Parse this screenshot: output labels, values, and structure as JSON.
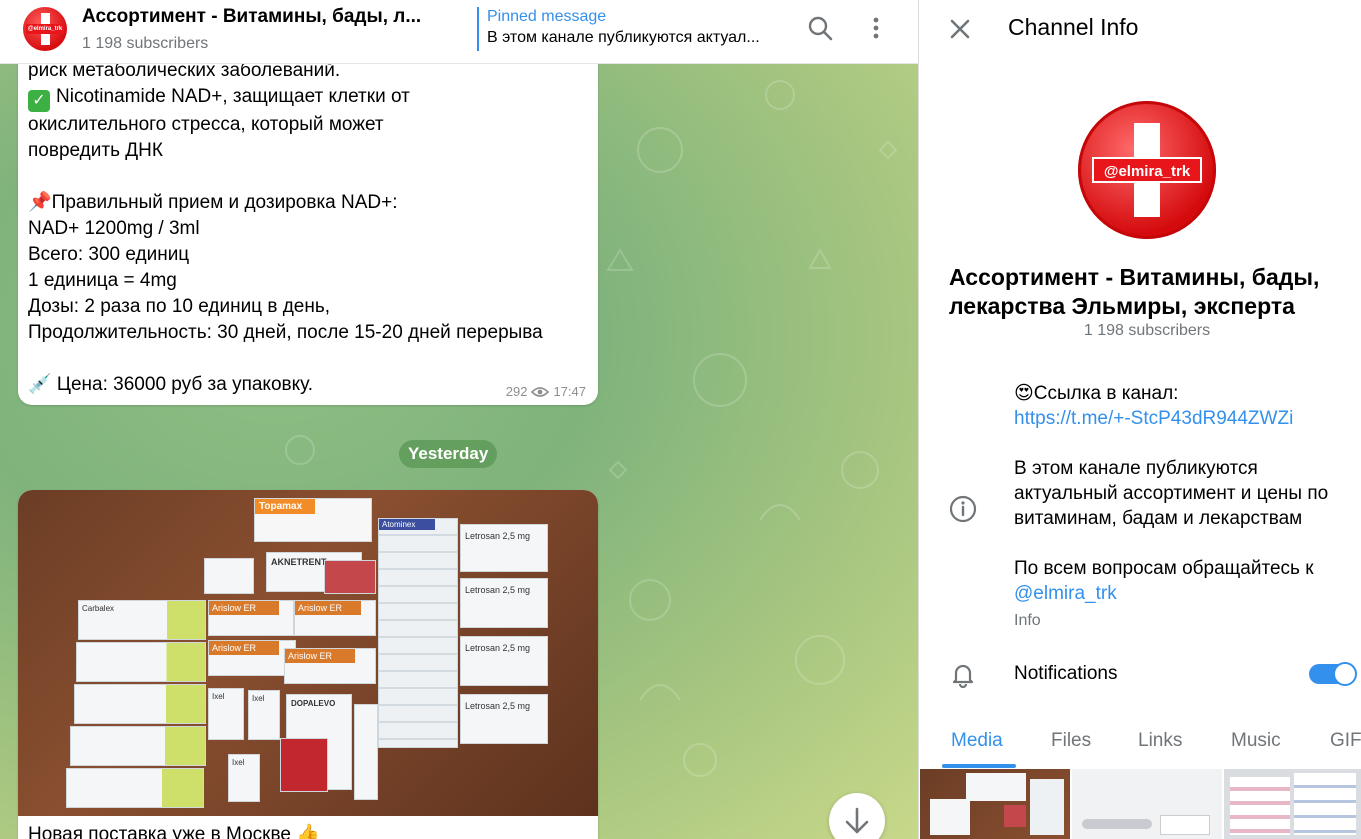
{
  "header": {
    "avatar_tag": "@elmira_trk",
    "title": "Ассортимент - Витамины, бады, л...",
    "subscribers": "1 198 subscribers",
    "pinned_label": "Pinned message",
    "pinned_text": "В этом канале публикуются актуал...",
    "search_icon": "search-icon",
    "more_icon": "more-vertical-icon"
  },
  "messages": [
    {
      "lines": [
        "риск метаболических заболеваний.",
        "Nicotinamide NAD+, защищает клетки от",
        "окислительного стресса, который может",
        "повредить ДНК",
        "",
        "📌Правильный прием и дозировка NAD+:",
        "NAD+ 1200mg / 3ml",
        "Всего: 300 единиц",
        "1 единица = 4mg",
        "Дозы: 2 раза по 10 единиц в день,",
        "Продолжительность: 30 дней, после 15-20 дней перерыва",
        "",
        "💉 Цена: 36000 руб за упаковку."
      ],
      "views": "292",
      "time": "17:47"
    },
    {
      "caption": "Новая поставка уже в Москве 👍"
    }
  ],
  "date_separator": "Yesterday",
  "photo_labels": [
    "Topamax",
    "AKNETRENT",
    "Arislow ER",
    "Arislow ER",
    "Arislow ER",
    "Arislow ER",
    "Atominex",
    "Letrosan 2,5 mg",
    "Letrosan 2,5 mg",
    "Letrosan 2,5 mg",
    "Letrosan 2,5 mg",
    "DOPALEVO",
    "Ixel",
    "Ixel",
    "Ixel",
    "Carbalex"
  ],
  "info_panel": {
    "title": "Channel Info",
    "avatar_tag": "@elmira_trk",
    "name": "Ассортимент - Витамины, бады, лекарства Эльмиры, эксперта",
    "subscribers": "1 198 subscribers",
    "desc_line1": "😍Ссылка в канал:",
    "desc_link": "https://t.me/+-StcP43dR944ZWZi",
    "desc_para2": "В этом канале публикуются актуальный ассортимент и цены по витаминам, бадам и лекарствам",
    "desc_para3": "По всем вопросам обращайтесь к",
    "desc_username": "@elmira_trk",
    "desc_label": "Info",
    "notifications_label": "Notifications",
    "notifications_on": true,
    "tabs": [
      "Media",
      "Files",
      "Links",
      "Music",
      "GIF"
    ],
    "active_tab": "Media"
  },
  "colors": {
    "accent": "#3390ec",
    "brand_red": "#e8151a",
    "chat_green": "#8fbf84"
  }
}
